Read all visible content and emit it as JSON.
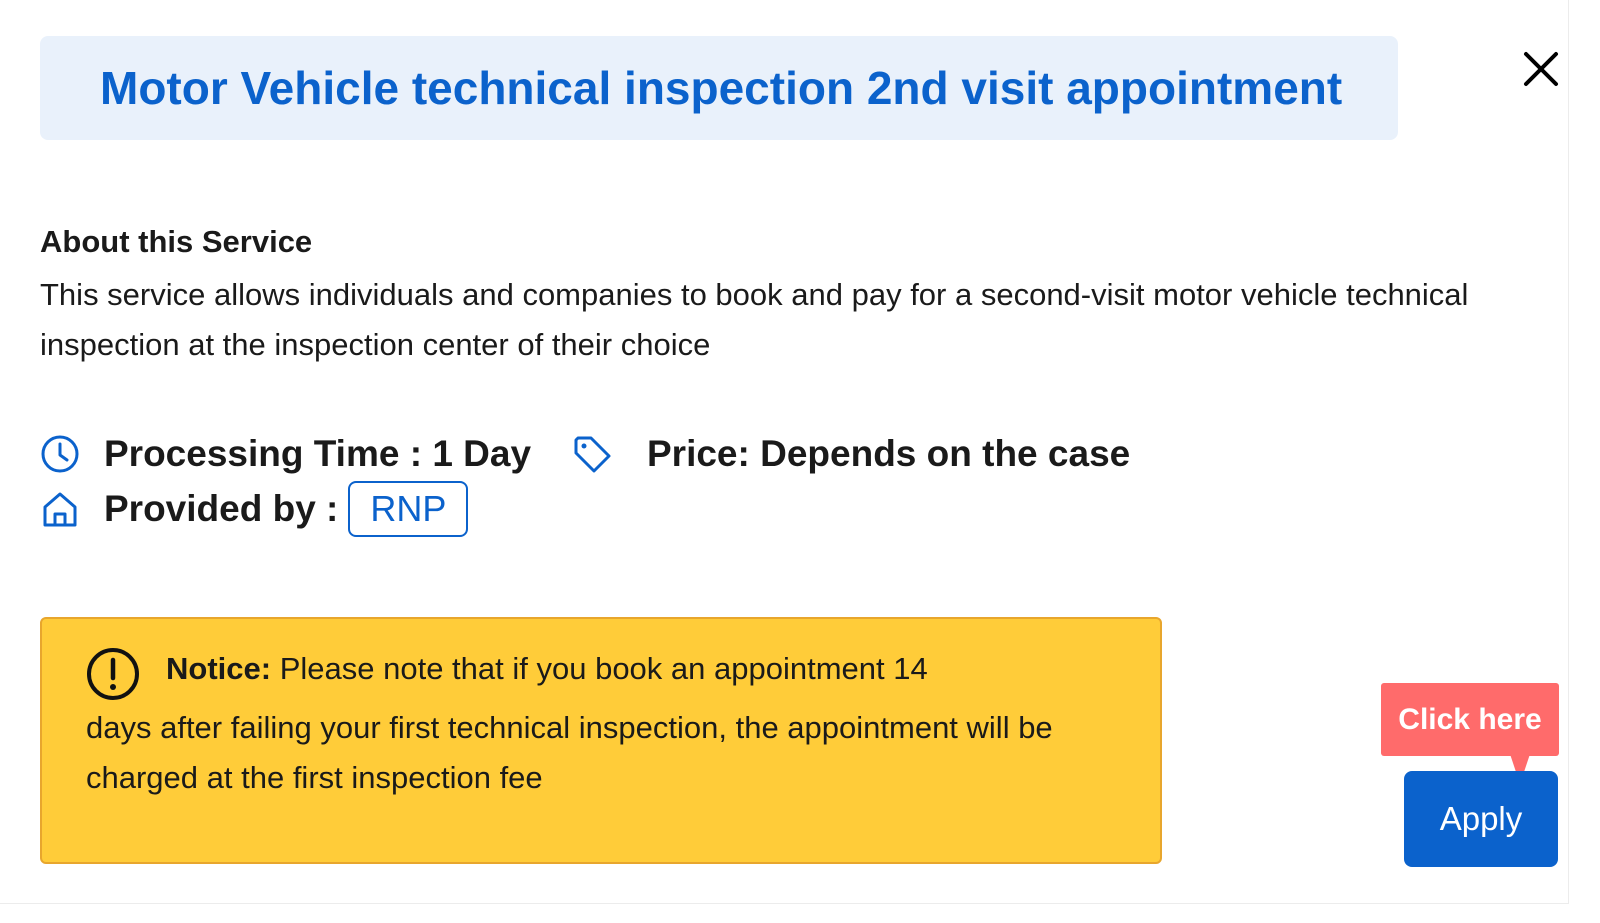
{
  "header": {
    "title": "Motor Vehicle technical inspection 2nd visit appointment",
    "close_icon": "close-icon"
  },
  "about": {
    "heading": "About this Service",
    "body": "This service allows individuals and companies to book and pay for a second-visit motor vehicle technical inspection at the inspection center of their choice"
  },
  "meta": {
    "processing_time": "Processing Time : 1 Day",
    "processing_icon": "clock-icon",
    "price": "Price: Depends on the case",
    "price_icon": "tag-icon",
    "provided_by_label": "Provided by :",
    "provided_by_icon": "home-icon",
    "provider": "RNP"
  },
  "notice": {
    "label": "Notice:",
    "line1": "Please note that if you book an appointment 14",
    "rest": "days after failing your first technical inspection, the appointment will be charged at the first inspection fee",
    "icon": "exclamation-circle-icon"
  },
  "actions": {
    "tooltip": "Click here",
    "apply_label": "Apply"
  },
  "colors": {
    "accent": "#0b62cc",
    "title_bg": "#e9f1fb",
    "notice_bg": "#ffcc39",
    "notice_border": "#e8a62d",
    "tooltip_bg": "#ff6b6b"
  }
}
